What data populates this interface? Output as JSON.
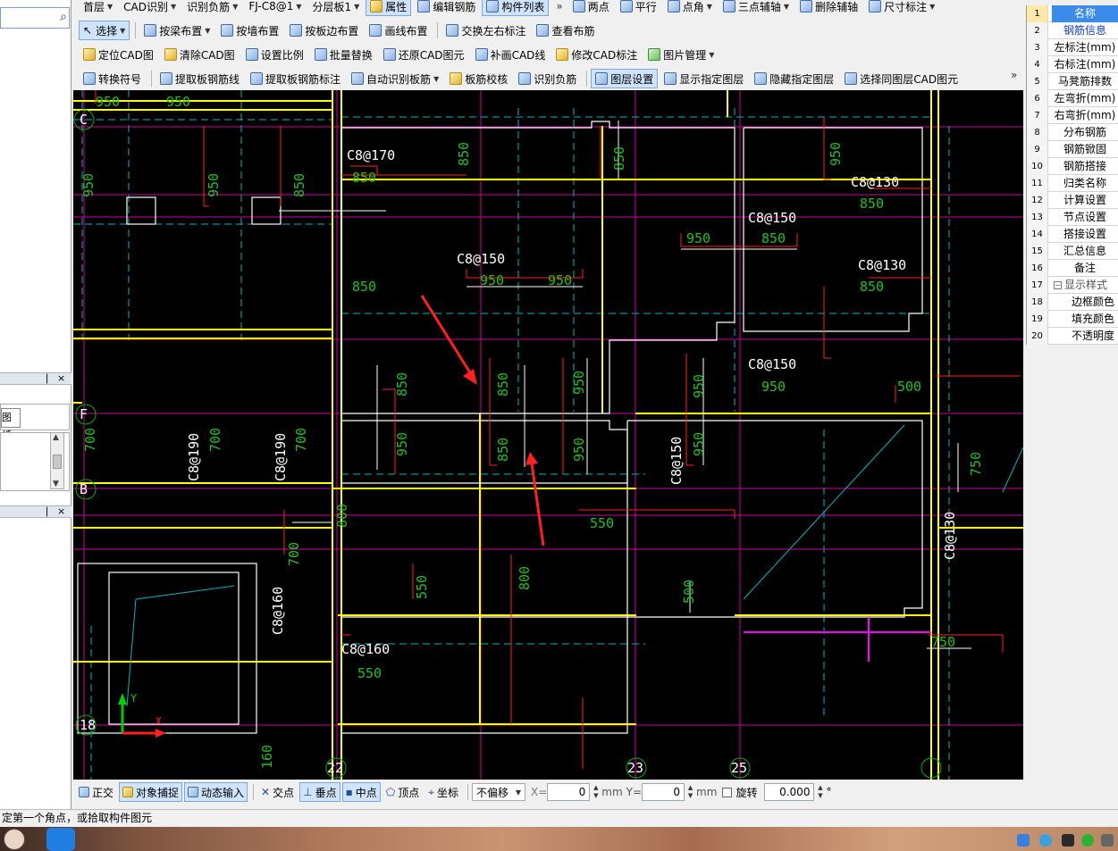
{
  "left_panel": {
    "search_placeholder": "",
    "dock1_pin": "❘",
    "dock1_close": "×",
    "tab_label": "图纸",
    "dock2_pin": "❘",
    "dock2_close": "×"
  },
  "toolbar_row1": {
    "floor": "首层",
    "cad_recognize": "CAD识别",
    "recognize_neg": "识别负筋",
    "component": "FJ-C8@1",
    "layer_board": "分层板1",
    "properties": "属性",
    "edit_rebar": "编辑钢筋",
    "component_list": "构件列表",
    "two_points": "两点",
    "parallel": "平行",
    "point_angle": "点角",
    "three_point_axis": "三点辅轴",
    "delete_axis": "删除辅轴",
    "dimension": "尺寸标注"
  },
  "toolbar_row2": {
    "select": "选择",
    "by_beam": "按梁布置",
    "by_wall": "按墙布置",
    "by_slab_edge": "按板边布置",
    "draw_line": "画线布置",
    "swap_labels": "交换左右标注",
    "view_layout": "查看布筋"
  },
  "toolbar_row3": {
    "locate_cad": "定位CAD图",
    "clear_cad": "清除CAD图",
    "set_scale": "设置比例",
    "batch_replace": "批量替换",
    "restore_cad": "还原CAD图元",
    "redraw_cad_line": "补画CAD线",
    "modify_cad_label": "修改CAD标注",
    "image_manage": "图片管理"
  },
  "toolbar_row4": {
    "convert_symbol": "转换符号",
    "extract_rebar_line": "提取板钢筋线",
    "extract_rebar_label": "提取板钢筋标注",
    "auto_recognize": "自动识别板筋",
    "rebar_check": "板筋校核",
    "recognize_neg": "识别负筋",
    "layer_settings": "图层设置",
    "show_layer": "显示指定图层",
    "hide_layer": "隐藏指定图层",
    "select_same_layer": "选择同图层CAD图元",
    "more": "»"
  },
  "properties": {
    "rows": [
      {
        "n": "1",
        "label": "名称"
      },
      {
        "n": "2",
        "label": "钢筋信息"
      },
      {
        "n": "3",
        "label": "左标注(mm)"
      },
      {
        "n": "4",
        "label": "右标注(mm)"
      },
      {
        "n": "5",
        "label": "马凳筋排数"
      },
      {
        "n": "6",
        "label": "左弯折(mm)"
      },
      {
        "n": "7",
        "label": "右弯折(mm)"
      },
      {
        "n": "8",
        "label": "分布钢筋"
      },
      {
        "n": "9",
        "label": "钢筋锨固"
      },
      {
        "n": "10",
        "label": "钢筋搭接"
      },
      {
        "n": "11",
        "label": "归类名称"
      },
      {
        "n": "12",
        "label": "计算设置"
      },
      {
        "n": "13",
        "label": "节点设置"
      },
      {
        "n": "14",
        "label": "搭接设置"
      },
      {
        "n": "15",
        "label": "汇总信息"
      },
      {
        "n": "16",
        "label": "备注"
      },
      {
        "n": "17",
        "label": "显示样式"
      },
      {
        "n": "18",
        "label": "边框颜色"
      },
      {
        "n": "19",
        "label": "填充颜色"
      },
      {
        "n": "20",
        "label": "不透明度"
      }
    ]
  },
  "drawing": {
    "rebar_labels": [
      "C8@170",
      "C8@150",
      "C8@150",
      "C8@130",
      "C8@130",
      "C8@150",
      "C8@190",
      "C8@190",
      "C8@150",
      "C8@130",
      "C8@160",
      "C8@160"
    ],
    "dims": [
      "950",
      "950",
      "850",
      "850",
      "950",
      "950",
      "950",
      "850",
      "850",
      "850",
      "950",
      "950",
      "850",
      "850",
      "850",
      "950",
      "700",
      "700",
      "700",
      "700",
      "550",
      "800",
      "550",
      "800",
      "500",
      "750",
      "750",
      "950",
      "950",
      "950",
      "950",
      "950",
      "850",
      "850",
      "850",
      "500",
      "950",
      "550",
      "160"
    ],
    "axis_labels": [
      "C",
      "F",
      "B",
      "18",
      "22",
      "23",
      "25"
    ],
    "colors": {
      "bg": "#000000",
      "yellow": "#ffff00",
      "magenta": "#ff00ff",
      "cyan": "#00c8c8",
      "red": "#ff2020",
      "green": "#00c000",
      "white": "#ffffff",
      "pink": "#d000a0"
    }
  },
  "statusbar": {
    "ortho": "正交",
    "osnap": "对象捕捉",
    "dynamic_input": "动态输入",
    "intersection": "交点",
    "perpendicular": "垂点",
    "midpoint": "中点",
    "vertex": "顶点",
    "coordinate": "坐标",
    "offset_mode": "不偏移",
    "x_label": "X=",
    "x_value": "0",
    "mm1": "mm",
    "y_label": "Y=",
    "y_value": "0",
    "mm2": "mm",
    "rotate": "旋转",
    "rotate_value": "0.000",
    "degree": "°"
  },
  "command_line": "定第一个角点，或拾取构件图元"
}
